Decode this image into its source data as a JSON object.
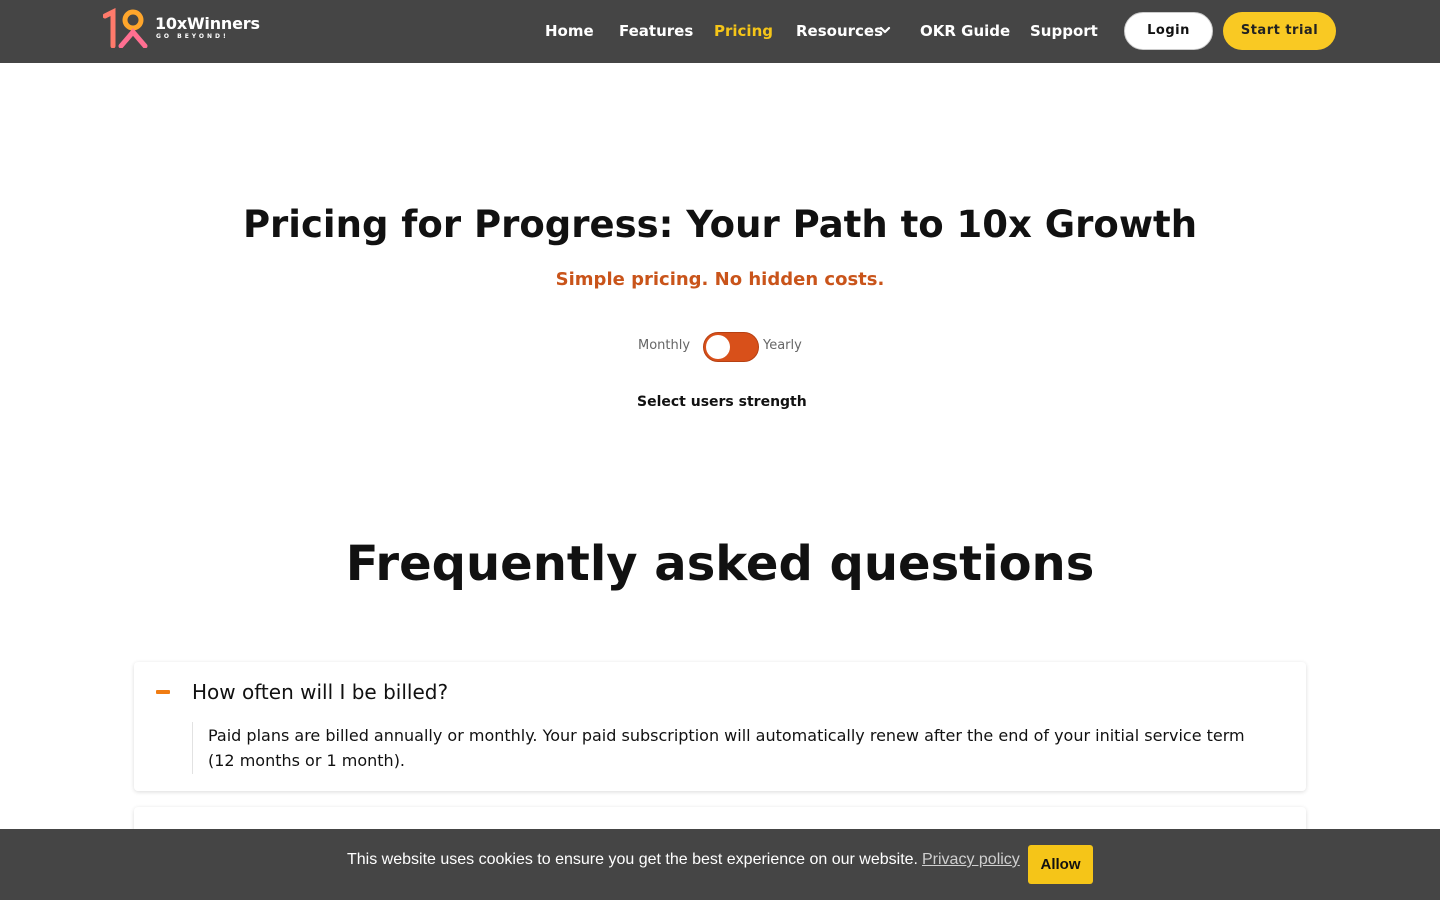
{
  "brand": {
    "name": "10xWinners",
    "tagline": "GO BEYOND!"
  },
  "nav": {
    "items": [
      {
        "label": "Home"
      },
      {
        "label": "Features"
      },
      {
        "label": "Pricing",
        "active": true
      },
      {
        "label": "Resources"
      },
      {
        "label": "OKR Guide"
      },
      {
        "label": "Support"
      }
    ],
    "login_label": "Login",
    "trial_label": "Start trial"
  },
  "hero": {
    "title": "Pricing for Progress: Your Path to 10x Growth",
    "subtitle": "Simple pricing. No hidden costs.",
    "billing_toggle": {
      "monthly_label": "Monthly",
      "yearly_label": "Yearly"
    },
    "users_strength_label": "Select users strength"
  },
  "faq": {
    "title": "Frequently asked questions",
    "items": [
      {
        "question": "How often will I be billed?",
        "answer": "Paid plans are billed annually or monthly. Your paid subscription will automatically renew after the end of your initial service term (12 months or 1 month).",
        "expanded": true
      }
    ]
  },
  "cookie_banner": {
    "message": "This website uses cookies to ensure you get the best experience on our website.",
    "policy_link": "Privacy policy",
    "allow_label": "Allow"
  },
  "colors": {
    "header_bg": "#454545",
    "accent_yellow": "#f9c923",
    "accent_orange": "#d8501a",
    "subtitle_orange": "#c9541a"
  }
}
